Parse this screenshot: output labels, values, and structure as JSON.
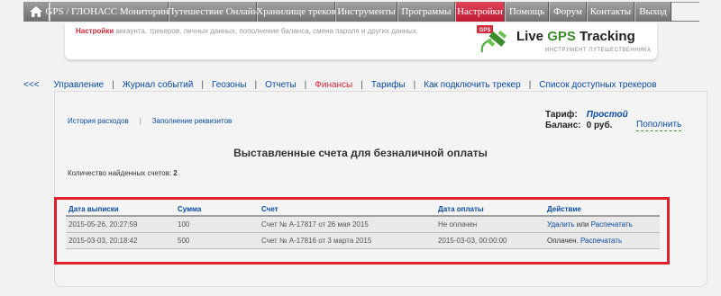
{
  "top_menu": {
    "items": [
      {
        "label": "GPS / ГЛОНАСС Мониторинг",
        "w": 132
      },
      {
        "label": "Путешествие Онлайн",
        "w": 98
      },
      {
        "label": "Хранилище треков",
        "w": 87
      },
      {
        "label": "Инструменты",
        "w": 69
      },
      {
        "label": "Программы",
        "w": 64
      },
      {
        "label": "Настройки",
        "w": 55,
        "active": true
      },
      {
        "label": "Помощь",
        "w": 49
      },
      {
        "label": "Форум",
        "w": 42
      },
      {
        "label": "Контакты",
        "w": 53
      },
      {
        "label": "Выход",
        "w": 41
      }
    ]
  },
  "banner": {
    "highlight": "Настройки",
    "text": " аккаунта, трекеров, личных данных, пополнение баланса, смена пароля и других данных.",
    "logo_badge": "GPS",
    "logo_title_1": "Live ",
    "logo_title_2": "GPS",
    "logo_title_3": " Tracking",
    "logo_subtitle": "ИНСТРУМЕНТ ПУТЕШЕСТВЕННИКА"
  },
  "subnav": {
    "back": "<<<",
    "items": [
      {
        "label": "Управление"
      },
      {
        "label": "Журнал событий"
      },
      {
        "label": "Геозоны"
      },
      {
        "label": "Отчеты"
      },
      {
        "label": "Финансы",
        "current": true
      },
      {
        "label": "Тарифы"
      },
      {
        "label": "Как подключить трекер"
      },
      {
        "label": "Список доступных трекеров"
      }
    ]
  },
  "finance": {
    "link_history": "История расходов",
    "link_requisites": "Заполнение реквизитов",
    "tariff_label": "Тариф:",
    "tariff_value": "Простой",
    "balance_label": "Баланс:",
    "balance_value": "0 руб.",
    "topup": "Пополнить",
    "title": "Выставленные счета для безналичной оплаты",
    "count_label": "Количество найденных счетов:",
    "count_value": "2"
  },
  "invoices": {
    "columns": [
      "Дата выписки",
      "Сумма",
      "Счет",
      "Дата оплаты",
      "Действие"
    ],
    "rows": [
      {
        "date": "2015-05-26, 20:27:59",
        "sum": "100",
        "invoice": "Счет № А-17817 от 26 мая 2015",
        "paid": "Не оплачен",
        "status": "",
        "action1": "Удалить",
        "or": " или ",
        "action2": "Распечатать"
      },
      {
        "date": "2015-03-03, 20:18:42",
        "sum": "500",
        "invoice": "Счет № А-17816 от 3 марта 2015",
        "paid": "2015-03-03, 00:00:00",
        "status": "Оплачен. ",
        "action1": "",
        "or": "",
        "action2": "Распечатать"
      }
    ]
  },
  "colors": {
    "accent": "#c01b33",
    "link": "#0a4aa0",
    "highlight_border": "#e0202a"
  }
}
